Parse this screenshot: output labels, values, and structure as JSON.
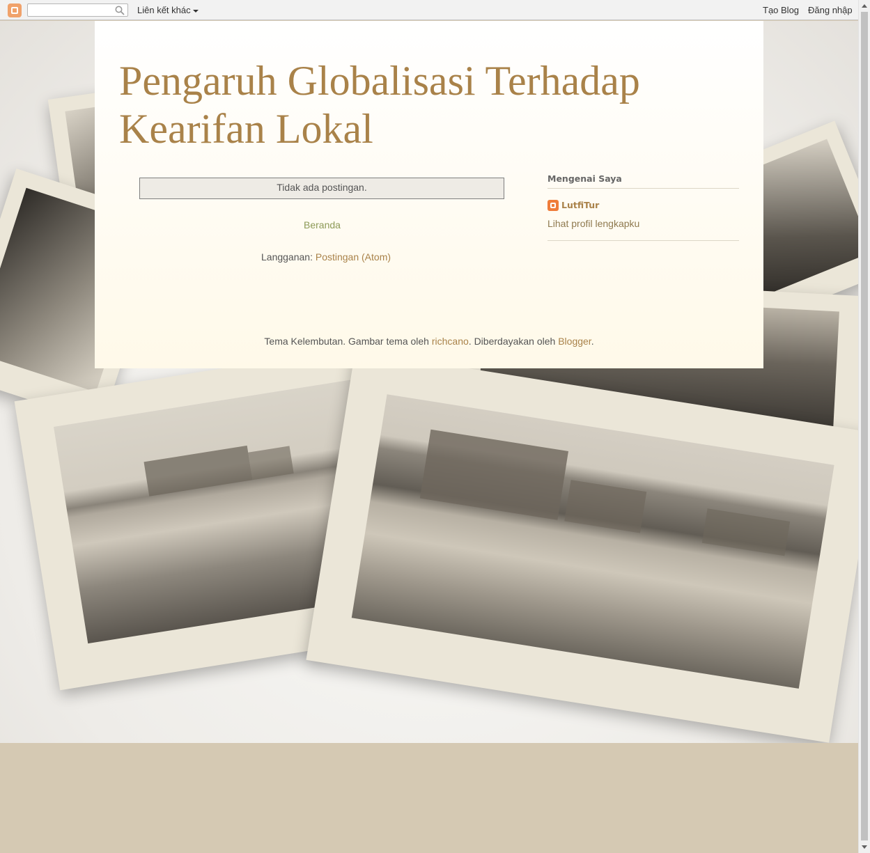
{
  "navbar": {
    "search_value": "",
    "more_label": "Liên kết khác",
    "create_blog": "Tạo Blog",
    "sign_in": "Đăng nhập"
  },
  "blog": {
    "title": "Pengaruh Globalisasi Terhadap Kearifan Lokal"
  },
  "main": {
    "no_posts": "Tidak ada postingan.",
    "home_link": "Beranda",
    "subscribe_label": "Langganan:",
    "subscribe_link": "Postingan (Atom)"
  },
  "sidebar": {
    "about_title": "Mengenai Saya",
    "profile_name": "LutfiTur",
    "profile_link": "Lihat profil lengkapku"
  },
  "footer": {
    "theme_text": "Tema Kelembutan. Gambar tema oleh",
    "theme_author": "richcano",
    "powered_text": ". Diberdayakan oleh",
    "powered_link": "Blogger",
    "end": "."
  },
  "colors": {
    "accent": "#a98249",
    "link_green": "#8c9a57",
    "page_bottom": "#d5c9b3"
  }
}
